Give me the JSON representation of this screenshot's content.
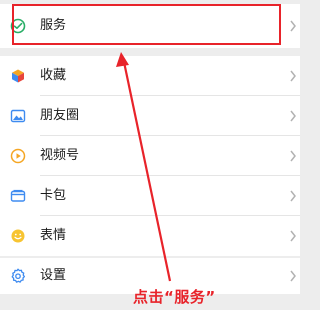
{
  "menu": {
    "items": [
      {
        "label": "服务",
        "icon": "service-icon"
      },
      {
        "label": "收藏",
        "icon": "favorites-cube-icon"
      },
      {
        "label": "朋友圈",
        "icon": "moments-image-icon"
      },
      {
        "label": "视频号",
        "icon": "channels-play-icon"
      },
      {
        "label": "卡包",
        "icon": "card-wallet-icon"
      },
      {
        "label": "表情",
        "icon": "emoji-smile-icon"
      },
      {
        "label": "设置",
        "icon": "settings-gear-icon"
      }
    ]
  },
  "annotation": {
    "text": "点击“服务”",
    "color": "#e8232a"
  }
}
